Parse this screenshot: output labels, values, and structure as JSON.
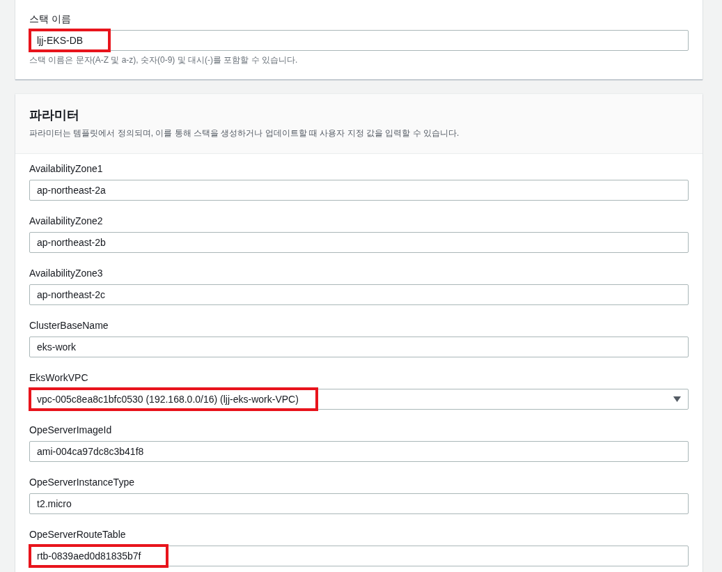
{
  "stack_name": {
    "label": "스택 이름",
    "value": "ljj-EKS-DB",
    "highlighted": true,
    "hint": "스택 이름은 문자(A-Z 및 a-z), 숫자(0-9) 및 대시(-)를 포함할 수 있습니다."
  },
  "parameters": {
    "title": "파라미터",
    "description": "파라미터는 템플릿에서 정의되며, 이를 통해 스택을 생성하거나 업데이트할 때 사용자 지정 값을 입력할 수 있습니다.",
    "fields": [
      {
        "label": "AvailabilityZone1",
        "value": "ap-northeast-2a",
        "kind": "text",
        "highlighted": false
      },
      {
        "label": "AvailabilityZone2",
        "value": "ap-northeast-2b",
        "kind": "text",
        "highlighted": false
      },
      {
        "label": "AvailabilityZone3",
        "value": "ap-northeast-2c",
        "kind": "text",
        "highlighted": false
      },
      {
        "label": "ClusterBaseName",
        "value": "eks-work",
        "kind": "text",
        "highlighted": false
      },
      {
        "label": "EksWorkVPC",
        "value": "vpc-005c8ea8c1bfc0530 (192.168.0.0/16) (ljj-eks-work-VPC)",
        "kind": "select",
        "highlighted": true
      },
      {
        "label": "OpeServerImageId",
        "value": "ami-004ca97dc8c3b41f8",
        "kind": "text",
        "highlighted": false
      },
      {
        "label": "OpeServerInstanceType",
        "value": "t2.micro",
        "kind": "text",
        "highlighted": false
      },
      {
        "label": "OpeServerRouteTable",
        "value": "rtb-0839aed0d81835b7f",
        "kind": "text",
        "highlighted": true
      }
    ]
  }
}
